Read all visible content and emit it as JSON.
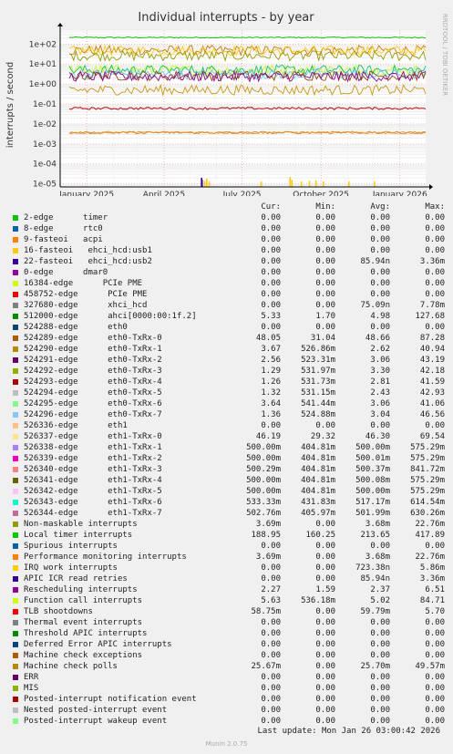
{
  "chart_data": {
    "type": "line",
    "title": "Individual interrupts - by year",
    "ylabel": "interrupts / second",
    "y_scale": "log",
    "ylim": [
      7e-06,
      500
    ],
    "y_ticks": [
      {
        "v": 100,
        "label": "1e+02"
      },
      {
        "v": 10,
        "label": "1e+01"
      },
      {
        "v": 1,
        "label": "1e+00"
      },
      {
        "v": 0.1,
        "label": "1e-01"
      },
      {
        "v": 0.01,
        "label": "1e-02"
      },
      {
        "v": 0.001,
        "label": "1e-03"
      },
      {
        "v": 0.0001,
        "label": "1e-04"
      },
      {
        "v": 1e-05,
        "label": "1e-05"
      }
    ],
    "x_range": [
      "2024-12-01",
      "2026-01-31"
    ],
    "x_ticks": [
      {
        "date": "2025-01-01",
        "label": "January 2025"
      },
      {
        "date": "2025-04-01",
        "label": "April 2025"
      },
      {
        "date": "2025-07-01",
        "label": "July 2025"
      },
      {
        "date": "2025-10-01",
        "label": "October 2025"
      },
      {
        "date": "2026-01-01",
        "label": "January 2026"
      }
    ],
    "grid": true,
    "series": [
      {
        "name": "Local timer interrupts",
        "color": "#00cc00",
        "level": 213.65
      },
      {
        "name": "eth0-TxRx-0",
        "color": "#cc7700",
        "level": 48.66
      },
      {
        "name": "eth1-TxRx-0",
        "color": "#ffcc00",
        "level": 46.3
      },
      {
        "name": "Machine check polls",
        "color": "#999900",
        "level": 25.7
      },
      {
        "name": "Function call interrupts",
        "color": "#ccff00",
        "level": 5.02
      },
      {
        "name": "ahci[0000:00:1f.2]",
        "color": "#00cc66",
        "level": 4.98
      },
      {
        "name": "eth0-TxRx-7",
        "color": "#66ccff",
        "level": 3.04
      },
      {
        "name": "eth0-TxRx-1",
        "color": "#994400",
        "level": 2.62
      },
      {
        "name": "Rescheduling interrupts",
        "color": "#990099",
        "level": 2.37
      },
      {
        "name": "eth1-TxRx-1",
        "color": "#cc9900",
        "level": 0.5
      },
      {
        "name": "TLB shootdowns",
        "color": "#cc0000",
        "level": 0.05979
      },
      {
        "name": "Non-maskable interrupts",
        "color": "#cc9966",
        "level": 0.00368
      },
      {
        "name": "Performance monitoring interrupts",
        "color": "#ff8800",
        "level": 0.00368
      },
      {
        "name": "ehci_hcd:usb2",
        "color": "#330099",
        "spikes": [
          [
            0.387,
            2e-05
          ],
          [
            0.3883,
            1.6e-05
          ]
        ]
      },
      {
        "name": "IRQ work interrupts",
        "color": "#ffcc00",
        "spikes": [
          [
            0.395,
            1.4e-05
          ],
          [
            0.401,
            1.8e-05
          ],
          [
            0.408,
            1.3e-05
          ],
          [
            0.55,
            1.3e-05
          ],
          [
            0.629,
            2.2e-05
          ],
          [
            0.634,
            1.6e-05
          ],
          [
            0.66,
            1.3e-05
          ],
          [
            0.682,
            1.4e-05
          ],
          [
            0.7,
            1.5e-05
          ],
          [
            0.72,
            1.3e-05
          ],
          [
            0.79,
            1.3e-05
          ],
          [
            0.86,
            1.3e-05
          ]
        ]
      }
    ]
  },
  "side_label": "RRDTOOL / TOBI OETIKER",
  "legend": {
    "headers": {
      "cur": "Cur:",
      "min": "Min:",
      "avg": "Avg:",
      "max": "Max:"
    },
    "rows": [
      {
        "name": "2-edge      timer",
        "color": "#00cc00",
        "cur": "0.00",
        "min": "0.00",
        "avg": "0.00",
        "max": "0.00"
      },
      {
        "name": "8-edge      rtc0",
        "color": "#0066b3",
        "cur": "0.00",
        "min": "0.00",
        "avg": "0.00",
        "max": "0.00"
      },
      {
        "name": "9-fasteoi   acpi",
        "color": "#ff8000",
        "cur": "0.00",
        "min": "0.00",
        "avg": "0.00",
        "max": "0.00"
      },
      {
        "name": "16-fasteoi   ehci_hcd:usb1",
        "color": "#ffcc00",
        "cur": "0.00",
        "min": "0.00",
        "avg": "0.00",
        "max": "0.00"
      },
      {
        "name": "22-fasteoi   ehci_hcd:usb2",
        "color": "#330099",
        "cur": "0.00",
        "min": "0.00",
        "avg": "85.94n",
        "max": "3.36m"
      },
      {
        "name": "0-edge      dmar0",
        "color": "#990099",
        "cur": "0.00",
        "min": "0.00",
        "avg": "0.00",
        "max": "0.00"
      },
      {
        "name": "16384-edge      PCIe PME",
        "color": "#ccff00",
        "cur": "0.00",
        "min": "0.00",
        "avg": "0.00",
        "max": "0.00"
      },
      {
        "name": "458752-edge      PCIe PME",
        "color": "#ff0000",
        "cur": "0.00",
        "min": "0.00",
        "avg": "0.00",
        "max": "0.00"
      },
      {
        "name": "327680-edge      xhci_hcd",
        "color": "#808080",
        "cur": "0.00",
        "min": "0.00",
        "avg": "75.09n",
        "max": "7.78m"
      },
      {
        "name": "512000-edge      ahci[0000:00:1f.2]",
        "color": "#008f00",
        "cur": "5.33",
        "min": "1.70",
        "avg": "4.98",
        "max": "127.68"
      },
      {
        "name": "524288-edge      eth0",
        "color": "#00487d",
        "cur": "0.00",
        "min": "0.00",
        "avg": "0.00",
        "max": "0.00"
      },
      {
        "name": "524289-edge      eth0-TxRx-0",
        "color": "#b35a00",
        "cur": "48.05",
        "min": "31.04",
        "avg": "48.66",
        "max": "87.28"
      },
      {
        "name": "524290-edge      eth0-TxRx-1",
        "color": "#b38f00",
        "cur": "3.67",
        "min": "526.86m",
        "avg": "2.62",
        "max": "40.94"
      },
      {
        "name": "524291-edge      eth0-TxRx-2",
        "color": "#6b006b",
        "cur": "2.56",
        "min": "523.31m",
        "avg": "3.06",
        "max": "43.19"
      },
      {
        "name": "524292-edge      eth0-TxRx-3",
        "color": "#8fb300",
        "cur": "1.29",
        "min": "531.97m",
        "avg": "3.30",
        "max": "42.18"
      },
      {
        "name": "524293-edge      eth0-TxRx-4",
        "color": "#b30000",
        "cur": "1.26",
        "min": "531.73m",
        "avg": "2.81",
        "max": "41.59"
      },
      {
        "name": "524294-edge      eth0-TxRx-5",
        "color": "#bebebe",
        "cur": "1.32",
        "min": "531.15m",
        "avg": "2.43",
        "max": "42.93"
      },
      {
        "name": "524295-edge      eth0-TxRx-6",
        "color": "#80ff80",
        "cur": "3.64",
        "min": "541.44m",
        "avg": "3.06",
        "max": "41.06"
      },
      {
        "name": "524296-edge      eth0-TxRx-7",
        "color": "#80c9ff",
        "cur": "1.36",
        "min": "524.88m",
        "avg": "3.04",
        "max": "46.56"
      },
      {
        "name": "526336-edge      eth1",
        "color": "#ffc080",
        "cur": "0.00",
        "min": "0.00",
        "avg": "0.00",
        "max": "0.00"
      },
      {
        "name": "526337-edge      eth1-TxRx-0",
        "color": "#ffe680",
        "cur": "46.19",
        "min": "29.32",
        "avg": "46.30",
        "max": "69.54"
      },
      {
        "name": "526338-edge      eth1-TxRx-1",
        "color": "#aa80ff",
        "cur": "500.00m",
        "min": "404.81m",
        "avg": "500.00m",
        "max": "575.29m"
      },
      {
        "name": "526339-edge      eth1-TxRx-2",
        "color": "#ee00cc",
        "cur": "500.00m",
        "min": "404.81m",
        "avg": "500.01m",
        "max": "575.29m"
      },
      {
        "name": "526340-edge      eth1-TxRx-3",
        "color": "#ff8080",
        "cur": "500.29m",
        "min": "404.81m",
        "avg": "500.37m",
        "max": "841.72m"
      },
      {
        "name": "526341-edge      eth1-TxRx-4",
        "color": "#666600",
        "cur": "500.00m",
        "min": "404.81m",
        "avg": "500.08m",
        "max": "575.29m"
      },
      {
        "name": "526342-edge      eth1-TxRx-5",
        "color": "#ffbfff",
        "cur": "500.00m",
        "min": "404.81m",
        "avg": "500.00m",
        "max": "575.29m"
      },
      {
        "name": "526343-edge      eth1-TxRx-6",
        "color": "#00ffcc",
        "cur": "533.33m",
        "min": "431.83m",
        "avg": "517.17m",
        "max": "614.54m"
      },
      {
        "name": "526344-edge      eth1-TxRx-7",
        "color": "#cc6699",
        "cur": "502.76m",
        "min": "405.97m",
        "avg": "501.99m",
        "max": "630.26m"
      },
      {
        "name": "Non-maskable interrupts",
        "color": "#999900",
        "cur": "3.69m",
        "min": "0.00",
        "avg": "3.68m",
        "max": "22.76m"
      },
      {
        "name": "Local timer interrupts",
        "color": "#00cc00",
        "cur": "188.95",
        "min": "160.25",
        "avg": "213.65",
        "max": "417.89"
      },
      {
        "name": "Spurious interrupts",
        "color": "#0066b3",
        "cur": "0.00",
        "min": "0.00",
        "avg": "0.00",
        "max": "0.00"
      },
      {
        "name": "Performance monitoring interrupts",
        "color": "#ff8000",
        "cur": "3.69m",
        "min": "0.00",
        "avg": "3.68m",
        "max": "22.76m"
      },
      {
        "name": "IRQ work interrupts",
        "color": "#ffcc00",
        "cur": "0.00",
        "min": "0.00",
        "avg": "723.38n",
        "max": "5.86m"
      },
      {
        "name": "APIC ICR read retries",
        "color": "#330099",
        "cur": "0.00",
        "min": "0.00",
        "avg": "85.94n",
        "max": "3.36m"
      },
      {
        "name": "Rescheduling interrupts",
        "color": "#990099",
        "cur": "2.27",
        "min": "1.59",
        "avg": "2.37",
        "max": "6.51"
      },
      {
        "name": "Function call interrupts",
        "color": "#ccff00",
        "cur": "5.63",
        "min": "536.18m",
        "avg": "5.02",
        "max": "84.71"
      },
      {
        "name": "TLB shootdowns",
        "color": "#ff0000",
        "cur": "58.75m",
        "min": "0.00",
        "avg": "59.79m",
        "max": "5.70"
      },
      {
        "name": "Thermal event interrupts",
        "color": "#808080",
        "cur": "0.00",
        "min": "0.00",
        "avg": "0.00",
        "max": "0.00"
      },
      {
        "name": "Threshold APIC interrupts",
        "color": "#008f00",
        "cur": "0.00",
        "min": "0.00",
        "avg": "0.00",
        "max": "0.00"
      },
      {
        "name": "Deferred Error APIC interrupts",
        "color": "#00487d",
        "cur": "0.00",
        "min": "0.00",
        "avg": "0.00",
        "max": "0.00"
      },
      {
        "name": "Machine check exceptions",
        "color": "#b35a00",
        "cur": "0.00",
        "min": "0.00",
        "avg": "0.00",
        "max": "0.00"
      },
      {
        "name": "Machine check polls",
        "color": "#b38f00",
        "cur": "25.67m",
        "min": "0.00",
        "avg": "25.70m",
        "max": "49.57m"
      },
      {
        "name": "ERR",
        "color": "#6b006b",
        "cur": "0.00",
        "min": "0.00",
        "avg": "0.00",
        "max": "0.00"
      },
      {
        "name": "MIS",
        "color": "#8fb300",
        "cur": "0.00",
        "min": "0.00",
        "avg": "0.00",
        "max": "0.00"
      },
      {
        "name": "Posted-interrupt notification event",
        "color": "#b30000",
        "cur": "0.00",
        "min": "0.00",
        "avg": "0.00",
        "max": "0.00"
      },
      {
        "name": "Nested posted-interrupt event",
        "color": "#bebebe",
        "cur": "0.00",
        "min": "0.00",
        "avg": "0.00",
        "max": "0.00"
      },
      {
        "name": "Posted-interrupt wakeup event",
        "color": "#80ff80",
        "cur": "0.00",
        "min": "0.00",
        "avg": "0.00",
        "max": "0.00"
      }
    ]
  },
  "footer": {
    "last_update": "Last update: Mon Jan 26 03:00:42 2026",
    "version": "Munin 2.0.75"
  }
}
